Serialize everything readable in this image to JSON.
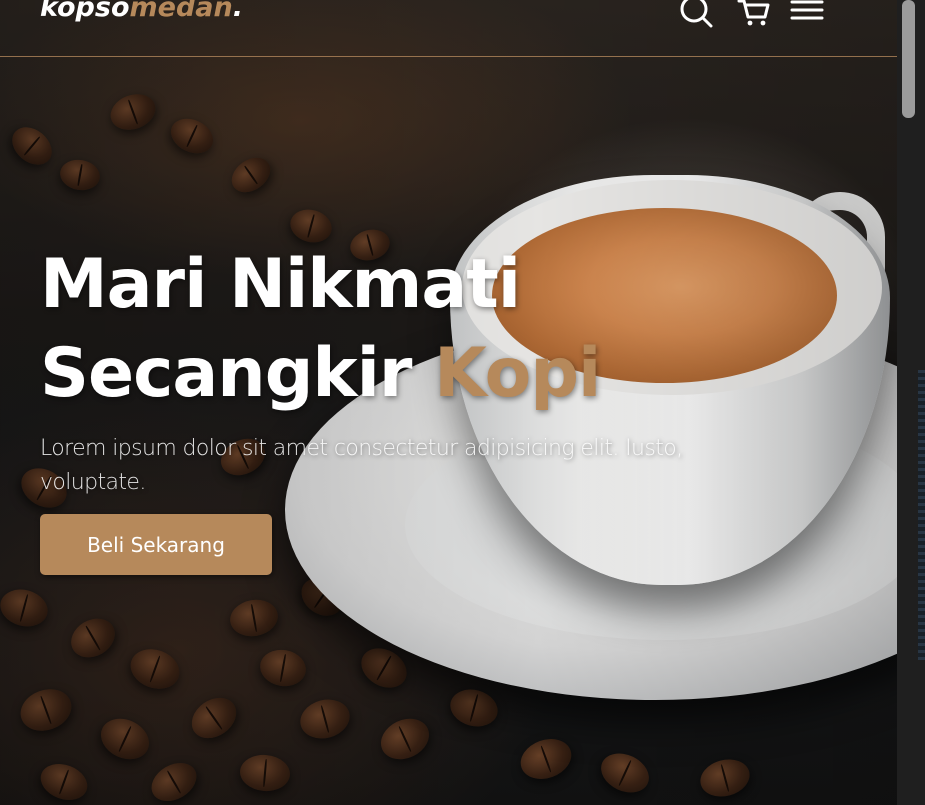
{
  "navbar": {
    "logo_main": "kopso",
    "logo_accent": "medan",
    "logo_dot": ".",
    "icons": [
      "search-icon",
      "shopping-cart-icon",
      "menu-icon"
    ]
  },
  "hero": {
    "title_line1": "Mari Nikmati",
    "title_line2": "Secangkir",
    "title_accent": "Kopi",
    "description": "Lorem ipsum dolor sit amet consectetur adipisicing elit. Iusto, voluptate.",
    "cta_label": "Beli Sekarang"
  },
  "colors": {
    "accent": "#b6895b",
    "text": "#ffffff",
    "navbar_border": "#b98c5f"
  }
}
